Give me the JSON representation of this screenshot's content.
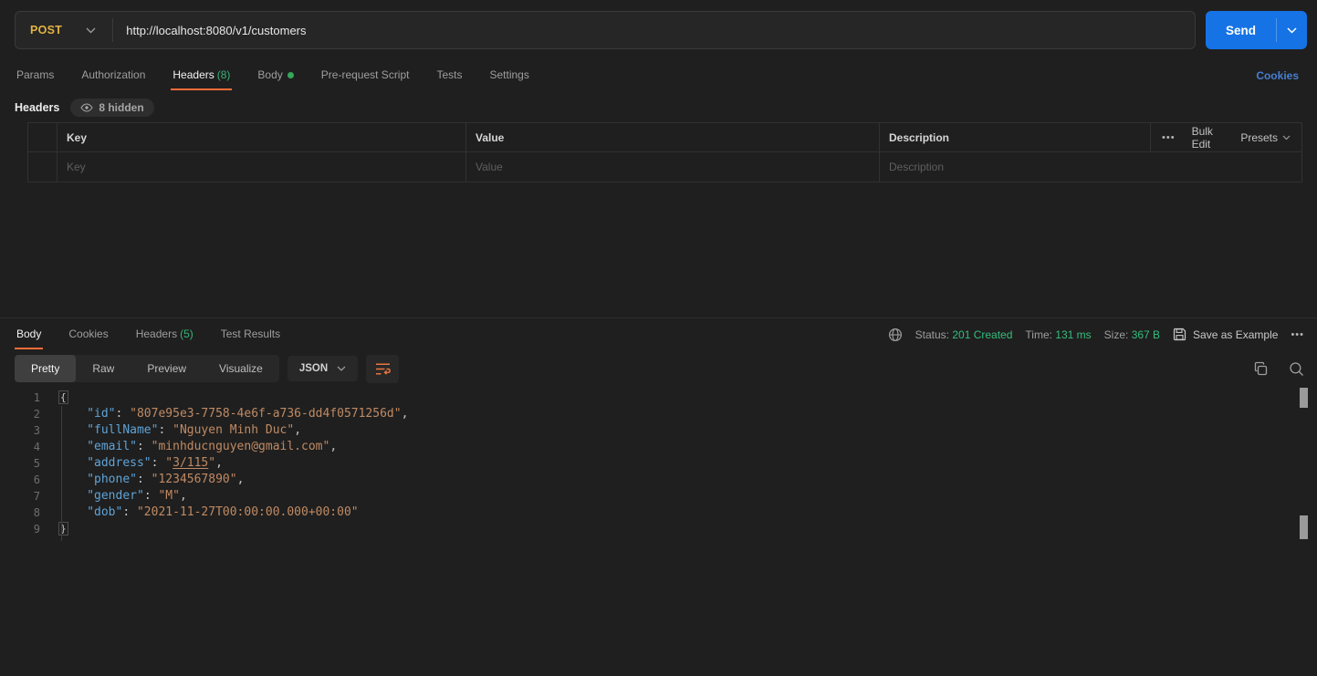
{
  "colors": {
    "accent_orange": "#ff6c37",
    "method_post": "#e3b341",
    "send_blue": "#1673e6",
    "status_green": "#35bd7d",
    "link_blue": "#467fd2"
  },
  "icons": {
    "ellipsis": "•••",
    "chevron": "⌄"
  },
  "request": {
    "method": "POST",
    "url": "http://localhost:8080/v1/customers",
    "send_label": "Send",
    "tabs": [
      {
        "label": "Params"
      },
      {
        "label": "Authorization"
      },
      {
        "label": "Headers",
        "count": "(8)"
      },
      {
        "label": "Body"
      },
      {
        "label": "Pre-request Script"
      },
      {
        "label": "Tests"
      },
      {
        "label": "Settings"
      }
    ],
    "cookies_link": "Cookies",
    "headers_section": {
      "title": "Headers",
      "hidden_badge": "8 hidden",
      "columns": {
        "key": "Key",
        "value": "Value",
        "description": "Description"
      },
      "placeholders": {
        "key": "Key",
        "value": "Value",
        "description": "Description"
      },
      "actions": {
        "bulk_edit": "Bulk Edit",
        "presets": "Presets"
      }
    }
  },
  "response": {
    "tabs": [
      {
        "label": "Body"
      },
      {
        "label": "Cookies"
      },
      {
        "label": "Headers",
        "count": "(5)"
      },
      {
        "label": "Test Results"
      }
    ],
    "meta": {
      "status_label": "Status:",
      "status_value": "201 Created",
      "time_label": "Time:",
      "time_value": "131 ms",
      "size_label": "Size:",
      "size_value": "367 B",
      "save_as_example": "Save as Example"
    },
    "toolbar": {
      "views": [
        "Pretty",
        "Raw",
        "Preview",
        "Visualize"
      ],
      "active_view": "Pretty",
      "format": "JSON"
    },
    "code": {
      "lines": [
        {
          "n": "1",
          "indent": 0,
          "tokens": [
            {
              "t": "{",
              "y": "brace"
            }
          ]
        },
        {
          "n": "2",
          "indent": 4,
          "tokens": [
            {
              "t": "\"id\"",
              "y": "key"
            },
            {
              "t": ": ",
              "y": "punc"
            },
            {
              "t": "\"807e95e3-7758-4e6f-a736-dd4f0571256d\"",
              "y": "str"
            },
            {
              "t": ",",
              "y": "punc"
            }
          ]
        },
        {
          "n": "3",
          "indent": 4,
          "tokens": [
            {
              "t": "\"fullName\"",
              "y": "key"
            },
            {
              "t": ": ",
              "y": "punc"
            },
            {
              "t": "\"Nguyen Minh Duc\"",
              "y": "str"
            },
            {
              "t": ",",
              "y": "punc"
            }
          ]
        },
        {
          "n": "4",
          "indent": 4,
          "tokens": [
            {
              "t": "\"email\"",
              "y": "key"
            },
            {
              "t": ": ",
              "y": "punc"
            },
            {
              "t": "\"minhducnguyen@gmail.com\"",
              "y": "str"
            },
            {
              "t": ",",
              "y": "punc"
            }
          ]
        },
        {
          "n": "5",
          "indent": 4,
          "tokens": [
            {
              "t": "\"address\"",
              "y": "key"
            },
            {
              "t": ": ",
              "y": "punc"
            },
            {
              "t": "\"",
              "y": "str"
            },
            {
              "t": "3/115",
              "y": "link"
            },
            {
              "t": "\"",
              "y": "str"
            },
            {
              "t": ",",
              "y": "punc"
            }
          ]
        },
        {
          "n": "6",
          "indent": 4,
          "tokens": [
            {
              "t": "\"phone\"",
              "y": "key"
            },
            {
              "t": ": ",
              "y": "punc"
            },
            {
              "t": "\"1234567890\"",
              "y": "str"
            },
            {
              "t": ",",
              "y": "punc"
            }
          ]
        },
        {
          "n": "7",
          "indent": 4,
          "tokens": [
            {
              "t": "\"gender\"",
              "y": "key"
            },
            {
              "t": ": ",
              "y": "punc"
            },
            {
              "t": "\"M\"",
              "y": "str"
            },
            {
              "t": ",",
              "y": "punc"
            }
          ]
        },
        {
          "n": "8",
          "indent": 4,
          "tokens": [
            {
              "t": "\"dob\"",
              "y": "key"
            },
            {
              "t": ": ",
              "y": "punc"
            },
            {
              "t": "\"2021-11-27T00:00:00.000+00:00\"",
              "y": "str"
            }
          ]
        },
        {
          "n": "9",
          "indent": 0,
          "tokens": [
            {
              "t": "}",
              "y": "brace"
            }
          ]
        }
      ]
    }
  }
}
